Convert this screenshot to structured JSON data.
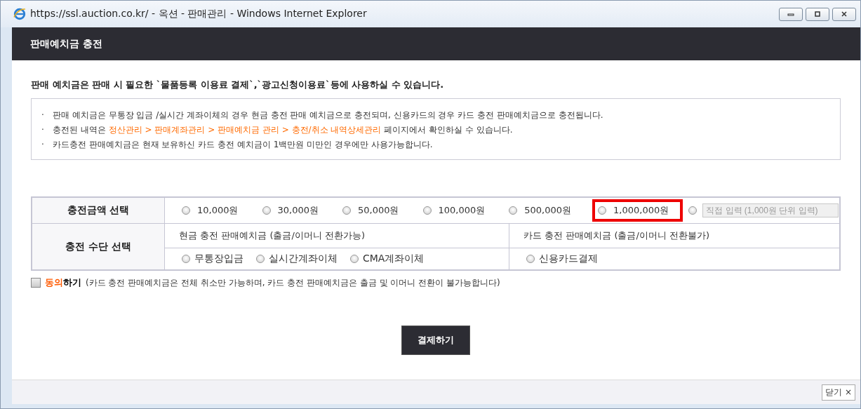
{
  "window": {
    "title": "https://ssl.auction.co.kr/ - 옥션 - 판매관리 - Windows Internet Explorer"
  },
  "header": {
    "title": "판매예치금 충전"
  },
  "intro": "판매 예치금은 판매 시 필요한 `물품등록 이용료 결제`,`광고신청이용료`등에 사용하실 수 있습니다.",
  "notes": [
    {
      "bullet": "·",
      "parts": [
        {
          "text": "판매 예치금은 무통장 입금 /실시간 계좌이체의 경우 현금 충전 판매 예치금으로 충전되며, 신용카드의 경우 카드 충전 판매예치금으로 충전됩니다.",
          "link": false
        }
      ]
    },
    {
      "bullet": "·",
      "parts": [
        {
          "text": "충전된 내역은 ",
          "link": false
        },
        {
          "text": "정산관리 > 판매계좌관리 > 판매예치금 관리 > 충전/취소 내역상세관리",
          "link": true
        },
        {
          "text": " 페이지에서 확인하실 수 있습니다.",
          "link": false
        }
      ]
    },
    {
      "bullet": "·",
      "parts": [
        {
          "text": "카드충전 판매예치금은 현재 보유하신 카드 충전 예치금이 1백만원 미만인 경우에만 사용가능합니다.",
          "link": false
        }
      ]
    }
  ],
  "amount": {
    "label": "충전금액 선택",
    "options": [
      {
        "label": "10,000원",
        "selected": false,
        "highlighted": false
      },
      {
        "label": "30,000원",
        "selected": false,
        "highlighted": false
      },
      {
        "label": "50,000원",
        "selected": false,
        "highlighted": false
      },
      {
        "label": "100,000원",
        "selected": false,
        "highlighted": false
      },
      {
        "label": "500,000원",
        "selected": false,
        "highlighted": false
      },
      {
        "label": "1,000,000원",
        "selected": false,
        "highlighted": true
      }
    ],
    "custom": {
      "selected": false,
      "placeholder": "직접 입력 (1,000원 단위 입력)",
      "disabled": true
    }
  },
  "method": {
    "label": "충전 수단 선택",
    "groups": [
      {
        "title": "현금 충전 판매예치금 (출금/이머니 전환가능)",
        "options": [
          {
            "label": "무통장입금",
            "selected": false
          },
          {
            "label": "실시간계좌이체",
            "selected": false
          },
          {
            "label": "CMA계좌이체",
            "selected": false
          }
        ]
      },
      {
        "title": "카드 충전 판매예치금 (출금/이머니 전환불가)",
        "options": [
          {
            "label": "신용카드결제",
            "selected": false
          }
        ]
      }
    ]
  },
  "agree": {
    "checked": false,
    "label_parts": [
      {
        "text": "동의",
        "accent": true
      },
      {
        "text": "하기",
        "accent": false
      }
    ],
    "note": "(카드 충전 판매예치금은 전체 취소만 가능하며, 카드 충전 판매예치금은 출금 및 이머니 전환이 불가능합니다)"
  },
  "pay_button": "결제하기",
  "close_button": "닫기 ×"
}
